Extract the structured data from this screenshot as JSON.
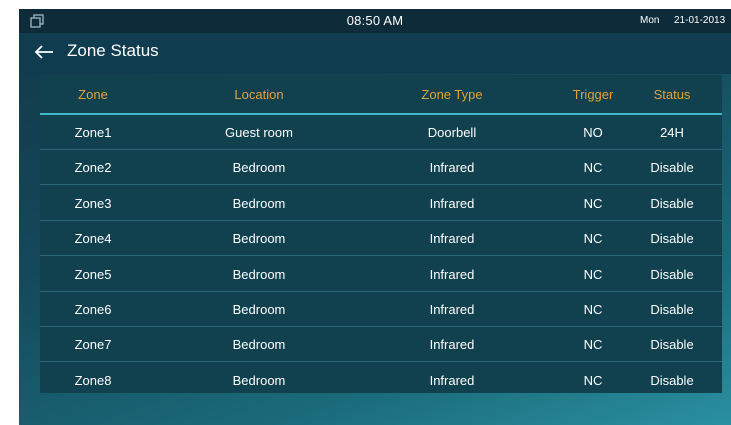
{
  "status_bar": {
    "icon": "window-restore-icon",
    "time": "08:50 AM",
    "day": "Mon",
    "date": "21-01-2013"
  },
  "header": {
    "back_icon": "back-arrow-icon",
    "title": "Zone Status"
  },
  "table": {
    "columns": [
      "Zone",
      "Location",
      "Zone Type",
      "Trigger",
      "Status"
    ],
    "rows": [
      [
        "Zone1",
        "Guest room",
        "Doorbell",
        "NO",
        "24H"
      ],
      [
        "Zone2",
        "Bedroom",
        "Infrared",
        "NC",
        "Disable"
      ],
      [
        "Zone3",
        "Bedroom",
        "Infrared",
        "NC",
        "Disable"
      ],
      [
        "Zone4",
        "Bedroom",
        "Infrared",
        "NC",
        "Disable"
      ],
      [
        "Zone5",
        "Bedroom",
        "Infrared",
        "NC",
        "Disable"
      ],
      [
        "Zone6",
        "Bedroom",
        "Infrared",
        "NC",
        "Disable"
      ],
      [
        "Zone7",
        "Bedroom",
        "Infrared",
        "NC",
        "Disable"
      ],
      [
        "Zone8",
        "Bedroom",
        "Infrared",
        "NC",
        "Disable"
      ]
    ]
  },
  "colors": {
    "header_text": "#e2a23a",
    "accent_line": "#3fb7c7",
    "table_bg": "#11404f"
  }
}
